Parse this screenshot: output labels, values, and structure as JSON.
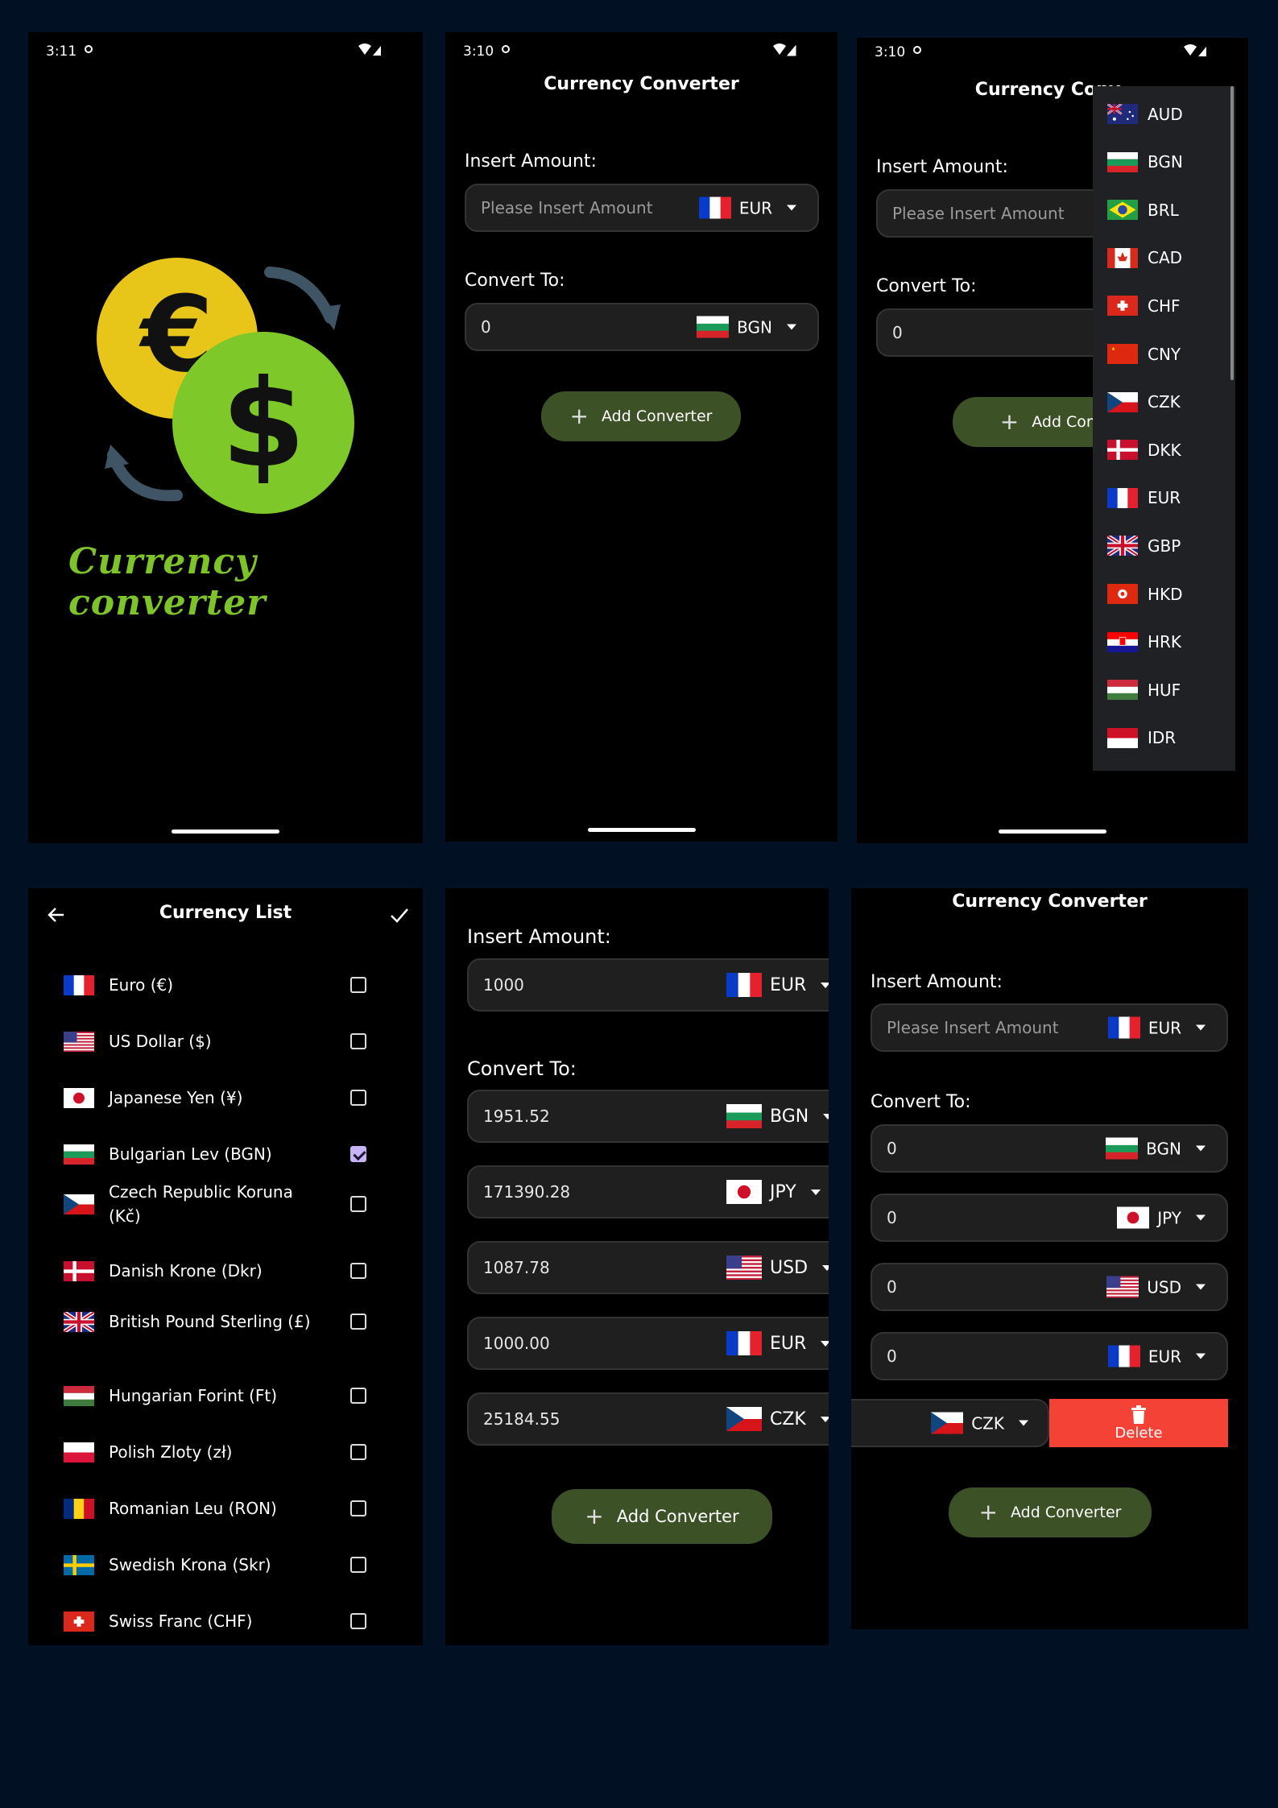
{
  "splash": {
    "time": "3:11",
    "logo_text": "Currency converter"
  },
  "screen2": {
    "time": "3:10",
    "title": "Currency Converter",
    "insert_label": "Insert Amount:",
    "amount_placeholder": "Please Insert Amount",
    "from_currency": "EUR",
    "convert_label": "Convert To:",
    "to_value": "0",
    "to_currency": "BGN",
    "add_label": "Add Converter"
  },
  "screen3": {
    "time": "3:10",
    "title": "Currency Conv",
    "insert_label": "Insert Amount:",
    "amount_placeholder": "Please Insert Amount",
    "convert_label": "Convert To:",
    "to_value": "0",
    "add_label": "Add Conv",
    "dropdown": [
      "AUD",
      "BGN",
      "BRL",
      "CAD",
      "CHF",
      "CNY",
      "CZK",
      "DKK",
      "EUR",
      "GBP",
      "HKD",
      "HRK",
      "HUF",
      "IDR"
    ]
  },
  "currency_list": {
    "title": "Currency List",
    "items": [
      {
        "name": "Euro   (€)",
        "flag": "fr",
        "checked": false
      },
      {
        "name": "US Dollar   ($)",
        "flag": "us",
        "checked": false
      },
      {
        "name": "Japanese Yen   (¥)",
        "flag": "jp",
        "checked": false
      },
      {
        "name": "Bulgarian Lev   (BGN)",
        "flag": "bg",
        "checked": true
      },
      {
        "name": "Czech Republic Koruna (Kč)",
        "flag": "cz",
        "checked": false
      },
      {
        "name": "Danish Krone   (Dkr)",
        "flag": "dk",
        "checked": false
      },
      {
        "name": "British Pound Sterling (£)",
        "flag": "gb",
        "checked": false
      },
      {
        "name": "Hungarian Forint   (Ft)",
        "flag": "hu",
        "checked": false
      },
      {
        "name": "Polish Zloty   (zł)",
        "flag": "pl",
        "checked": false
      },
      {
        "name": "Romanian Leu   (RON)",
        "flag": "ro",
        "checked": false
      },
      {
        "name": "Swedish Krona   (Skr)",
        "flag": "se",
        "checked": false
      },
      {
        "name": "Swiss Franc   (CHF)",
        "flag": "ch",
        "checked": false
      }
    ]
  },
  "screen5": {
    "insert_label": "Insert Amount:",
    "amount": "1000",
    "from_currency": "EUR",
    "convert_label": "Convert To:",
    "rows": [
      {
        "value": "1951.52",
        "currency": "BGN",
        "flag": "bg"
      },
      {
        "value": "171390.28",
        "currency": "JPY",
        "flag": "jp"
      },
      {
        "value": "1087.78",
        "currency": "USD",
        "flag": "us"
      },
      {
        "value": "1000.00",
        "currency": "EUR",
        "flag": "fr"
      },
      {
        "value": "25184.55",
        "currency": "CZK",
        "flag": "cz"
      }
    ],
    "add_label": "Add Converter"
  },
  "screen6": {
    "title": "Currency Converter",
    "insert_label": "Insert Amount:",
    "amount_placeholder": "Please Insert Amount",
    "from_currency": "EUR",
    "convert_label": "Convert To:",
    "rows": [
      {
        "value": "0",
        "currency": "BGN",
        "flag": "bg"
      },
      {
        "value": "0",
        "currency": "JPY",
        "flag": "jp"
      },
      {
        "value": "0",
        "currency": "USD",
        "flag": "us"
      },
      {
        "value": "0",
        "currency": "EUR",
        "flag": "fr"
      }
    ],
    "swiped_currency": "CZK",
    "delete_label": "Delete",
    "add_label": "Add Converter"
  },
  "colors": {
    "background": "#021024",
    "add_button": "#3d5127",
    "delete": "#f44336",
    "checkbox_on": "#c7b3f5"
  }
}
